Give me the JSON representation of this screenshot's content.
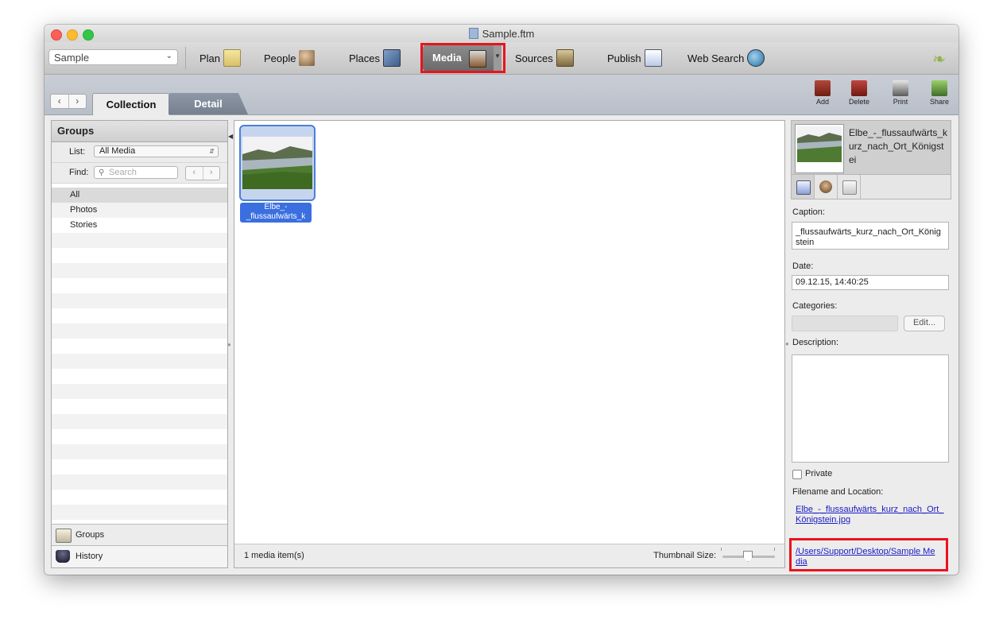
{
  "window": {
    "title": "Sample.ftm"
  },
  "toolbar": {
    "tree_select": "Sample",
    "buttons": [
      {
        "label": "Plan",
        "icon": "plan-notepad-icon"
      },
      {
        "label": "People",
        "icon": "people-icon"
      },
      {
        "label": "Places",
        "icon": "places-map-icon"
      },
      {
        "label": "Media",
        "icon": "media-icon"
      },
      {
        "label": "Sources",
        "icon": "sources-scroll-icon"
      },
      {
        "label": "Publish",
        "icon": "publish-chart-icon"
      },
      {
        "label": "Web Search",
        "icon": "web-search-globe-icon"
      }
    ],
    "active": "Media"
  },
  "subbar": {
    "tabs": [
      {
        "label": "Collection"
      },
      {
        "label": "Detail"
      }
    ],
    "actions": [
      {
        "label": "Add"
      },
      {
        "label": "Delete"
      },
      {
        "label": "Print"
      },
      {
        "label": "Share"
      }
    ]
  },
  "groups_panel": {
    "header": "Groups",
    "list_label": "List:",
    "list_value": "All Media",
    "find_label": "Find:",
    "search_placeholder": "Search",
    "items": [
      "All",
      "Photos",
      "Stories"
    ],
    "selected": "All",
    "footer": [
      {
        "label": "Groups"
      },
      {
        "label": "History"
      }
    ]
  },
  "media_panel": {
    "item_caption": "Elbe_-\n_flussaufwärts_k",
    "count_text": "1 media item(s)",
    "thumbnail_size_label": "Thumbnail Size:",
    "thumbnail_size_level": 0.5
  },
  "detail_panel": {
    "title": "Elbe_-_flussaufwärts_kurz_nach_Ort_Königstei",
    "caption_label": "Caption:",
    "caption_value": "_flussaufwärts_kurz_nach_Ort_Königstein",
    "date_label": "Date:",
    "date_value": "09.12.15, 14:40:25",
    "categories_label": "Categories:",
    "edit_button": "Edit...",
    "description_label": "Description:",
    "private_label": "Private",
    "filename_label": "Filename and Location:",
    "filename_link": "Elbe_-_flussaufwärts_kurz_nach_Ort_Königstein.jpg",
    "location_link": "/Users/Support/Desktop/Sample Media"
  },
  "colors": {
    "highlight": "#e8141c",
    "selection_blue": "#3b6fe0",
    "link": "#1a1ac7"
  }
}
